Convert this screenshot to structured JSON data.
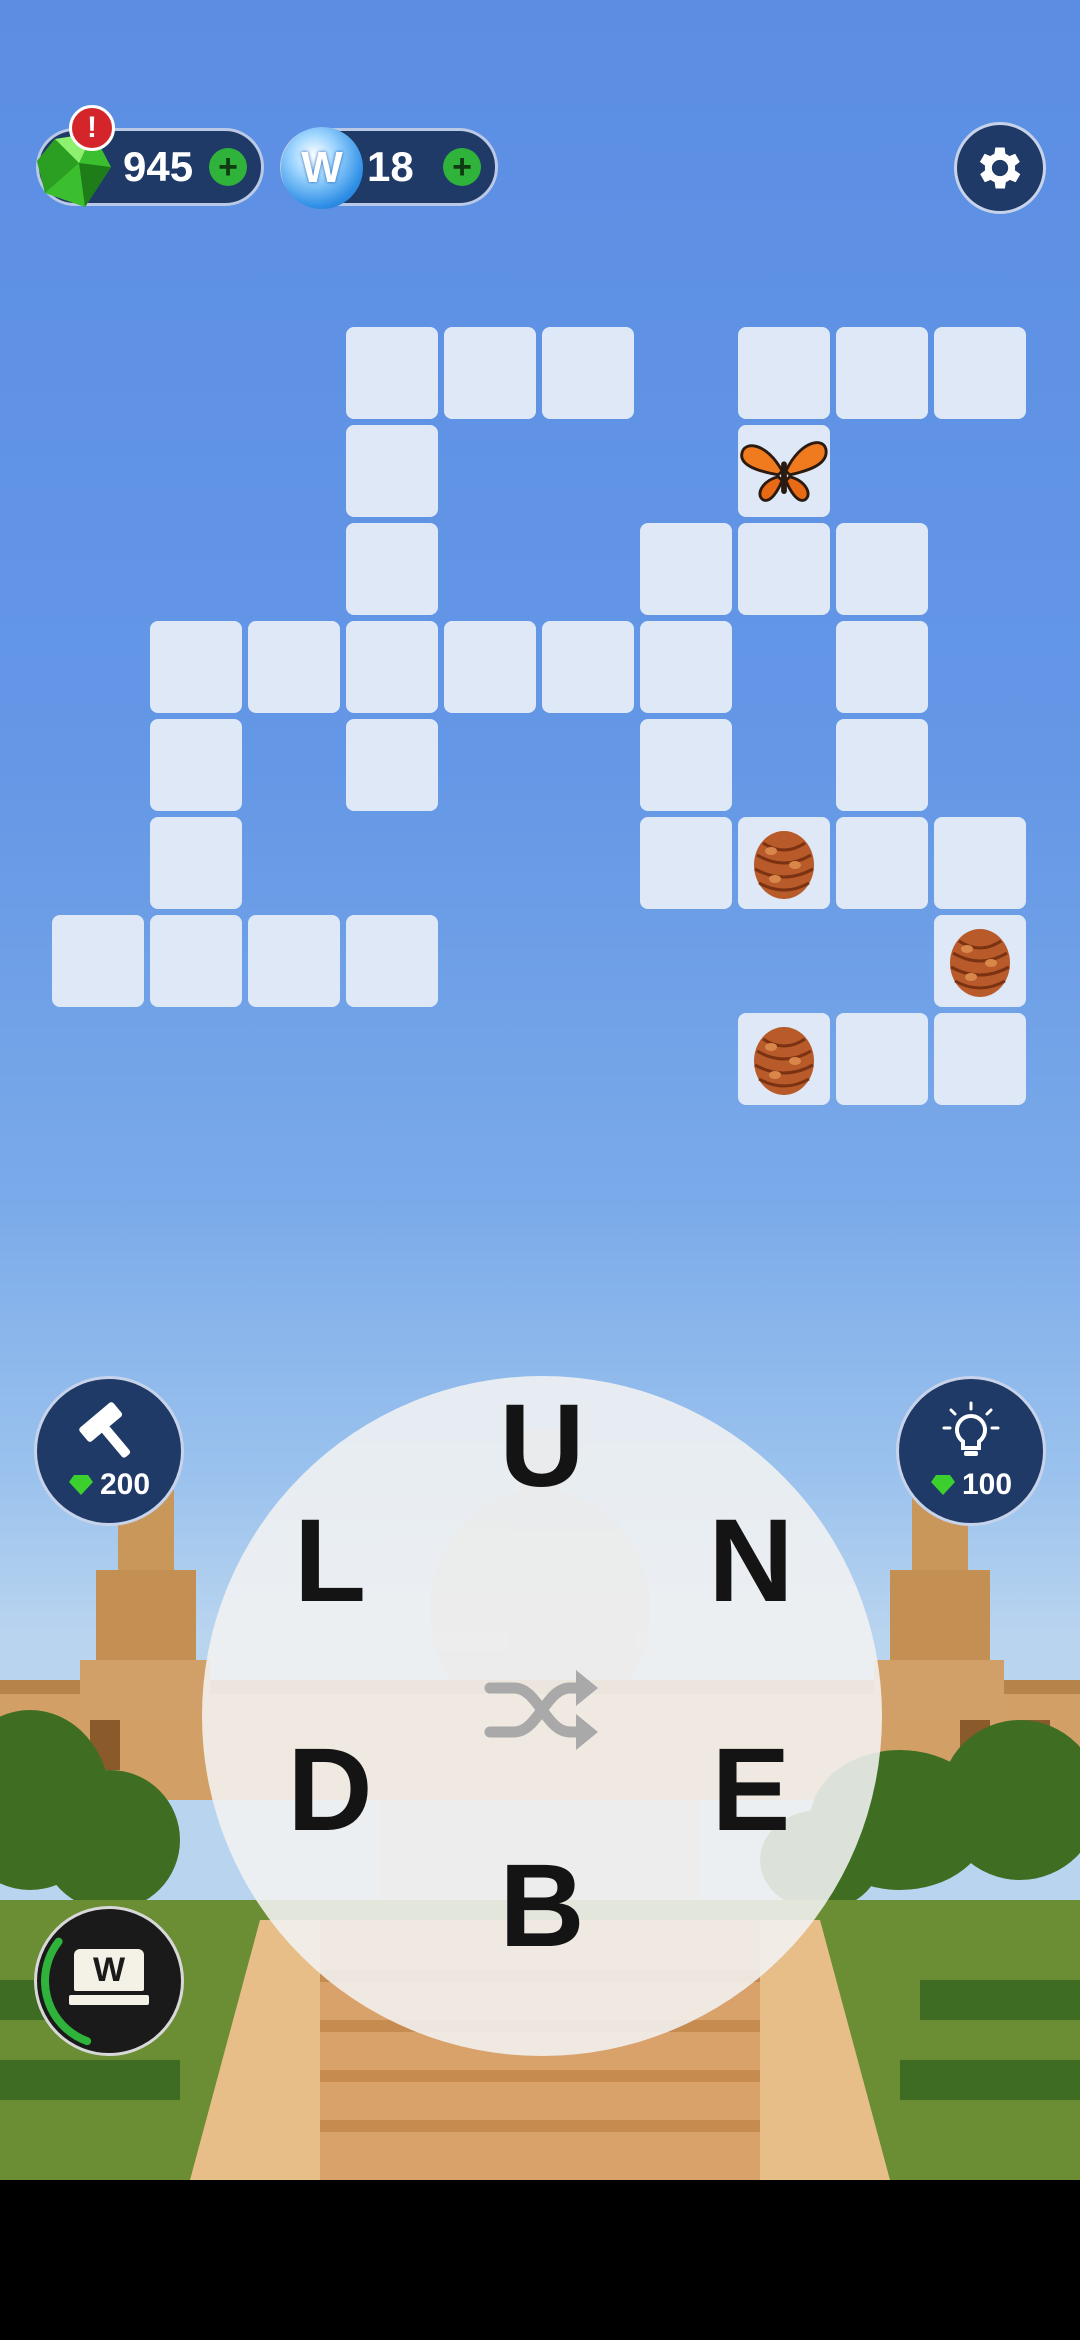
{
  "currency": {
    "gems": {
      "value": "945",
      "plus": "+",
      "alert": "!"
    },
    "coins": {
      "value": "18",
      "plus": "+",
      "emblem": "W"
    }
  },
  "settings": {
    "icon": "gear-icon"
  },
  "board": {
    "empty_cell_color": "#dee8f7",
    "bonus_items": [
      "butterfly",
      "pinecone",
      "pinecone",
      "pinecone"
    ]
  },
  "hammer_booster": {
    "icon": "hammer-icon",
    "cost": "200"
  },
  "hint_booster": {
    "icon": "lightbulb-icon",
    "cost": "100"
  },
  "wheel": {
    "letters": [
      "U",
      "N",
      "E",
      "B",
      "D",
      "L"
    ],
    "shuffle_icon": "shuffle-icon"
  },
  "word_book": {
    "emblem": "W",
    "progress": 0.3
  }
}
